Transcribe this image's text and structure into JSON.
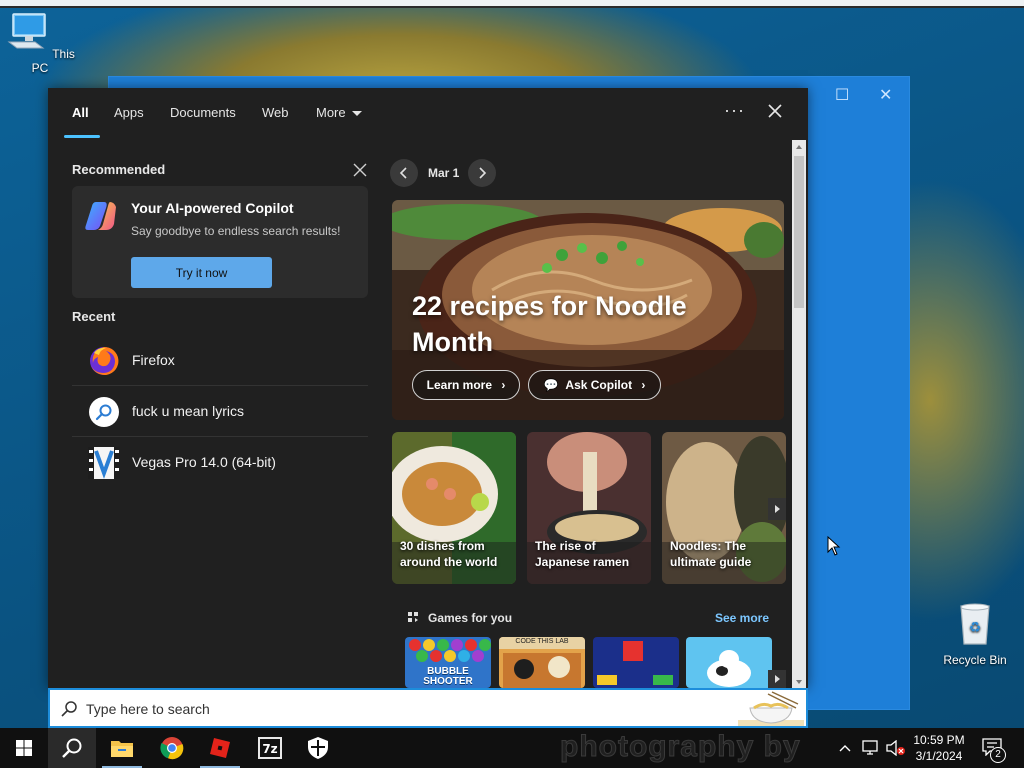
{
  "desktop": {
    "icons": [
      {
        "label": "This PC"
      },
      {
        "label": "Recycle Bin"
      }
    ]
  },
  "flyout": {
    "tabs": [
      {
        "label": "All"
      },
      {
        "label": "Apps"
      },
      {
        "label": "Documents"
      },
      {
        "label": "Web"
      },
      {
        "label": "More"
      }
    ],
    "more_options_label": "···",
    "recommended": {
      "title": "Recommended",
      "card": {
        "title": "Your AI-powered Copilot",
        "subtitle": "Say goodbye to endless search results!",
        "button": "Try it now"
      }
    },
    "recent": {
      "title": "Recent",
      "items": [
        {
          "label": "Firefox",
          "icon": "firefox-icon"
        },
        {
          "label": "fuck u mean lyrics",
          "icon": "search-icon"
        },
        {
          "label": "Vegas Pro 14.0 (64-bit)",
          "icon": "vegas-pro-icon"
        }
      ]
    },
    "today": {
      "date": "Mar 1",
      "hero": {
        "title": "22 recipes for Noodle Month",
        "learn_more": "Learn more",
        "ask_copilot": "Ask Copilot"
      },
      "cards": [
        {
          "caption": "30 dishes from around the world"
        },
        {
          "caption": "The rise of Japanese ramen"
        },
        {
          "caption": "Noodles: The ultimate guide"
        }
      ],
      "games": {
        "title": "Games for you",
        "see_more": "See more",
        "tiles": [
          {
            "label": "BUBBLE SHOOTER"
          },
          {
            "label": "CODE THIS LAB"
          },
          {
            "label": ""
          },
          {
            "label": ""
          }
        ]
      }
    }
  },
  "search": {
    "placeholder": "Type here to search"
  },
  "taskbar": {
    "watermark": "photography by",
    "apps": [
      "start",
      "search",
      "file-explorer",
      "chrome",
      "roblox",
      "7-zip",
      "security"
    ],
    "time": "10:59 PM",
    "date": "3/1/2024",
    "notification_count": "2"
  },
  "colors": {
    "accent": "#4cc2ff",
    "button": "#5ea8ea",
    "flyout_bg": "#202020",
    "desktop_blue": "#0b5a8c"
  }
}
